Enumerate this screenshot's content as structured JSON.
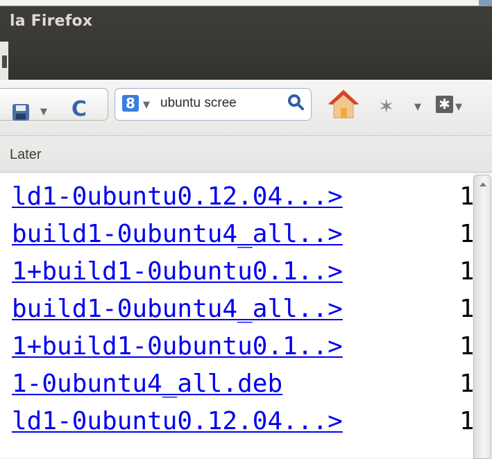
{
  "window": {
    "title": "la Firefox"
  },
  "toolbar": {
    "save_icon": "save-icon",
    "reload_icon": "reload-icon",
    "reload_glyph": "C",
    "search": {
      "engine_icon": "google-icon",
      "engine_glyph": "8",
      "value": "ubuntu scree"
    },
    "home_icon": "home-icon",
    "plugin_icon": "puzzle-icon",
    "extension_icon": "extension-icon"
  },
  "bookmarks": {
    "items": [
      {
        "label": "Later"
      }
    ]
  },
  "listing": {
    "rows": [
      {
        "name": "ld1-0ubuntu0.12.04...>",
        "size": "1"
      },
      {
        "name": "build1-0ubuntu4_all..>",
        "size": "1"
      },
      {
        "name": "1+build1-0ubuntu0.1..>",
        "size": "1"
      },
      {
        "name": "build1-0ubuntu4_all..>",
        "size": "1"
      },
      {
        "name": "1+build1-0ubuntu0.1..>",
        "size": "1"
      },
      {
        "name": "1-0ubuntu4_all.deb",
        "size": "1"
      },
      {
        "name": "ld1-0ubuntu0.12.04...>",
        "size": "1"
      }
    ]
  },
  "colors": {
    "link": "#0000ee",
    "titlebar": "#3c3b37",
    "title_text": "#dfdbd2"
  }
}
